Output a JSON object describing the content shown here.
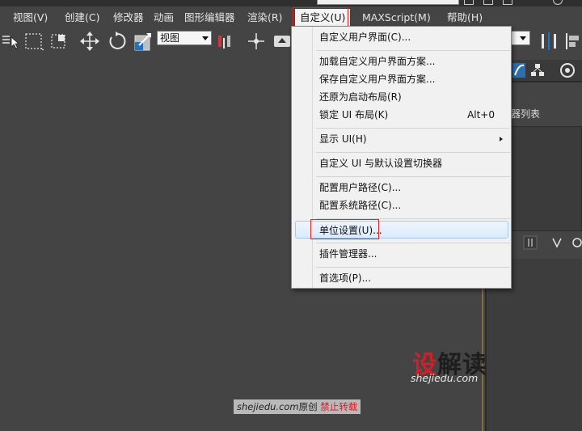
{
  "menubar": {
    "items": [
      {
        "label": "视图(V)"
      },
      {
        "label": "创建(C)"
      },
      {
        "label": "修改器"
      },
      {
        "label": "动画"
      },
      {
        "label": "图形编辑器"
      },
      {
        "label": "渲染(R)"
      },
      {
        "label": "自定义(U)"
      },
      {
        "label": "MAXScript(M)"
      },
      {
        "label": "帮助(H)"
      }
    ]
  },
  "toolbar": {
    "view_select": "视图"
  },
  "command_panel": {
    "label": "器列表"
  },
  "customize_menu": {
    "items": [
      {
        "label": "自定义用户界面(C)..."
      },
      {
        "label": "加载自定义用户界面方案..."
      },
      {
        "label": "保存自定义用户界面方案..."
      },
      {
        "label": "还原为启动布局(R)"
      },
      {
        "label": "锁定 UI 布局(K)",
        "shortcut": "Alt+0"
      },
      {
        "label": "显示 UI(H)"
      },
      {
        "label": "自定义 UI 与默认设置切换器"
      },
      {
        "label": "配置用户路径(C)..."
      },
      {
        "label": "配置系统路径(C)..."
      },
      {
        "label": "单位设置(U)..."
      },
      {
        "label": "插件管理器..."
      },
      {
        "label": "首选项(P)..."
      }
    ]
  },
  "watermark": {
    "logo_red": "设",
    "logo_dark": "解读",
    "url": "shejiedu.com",
    "bar_url": "shejiedu.com",
    "bar_original": "原创",
    "bar_notice": "禁止转载"
  },
  "colors": {
    "background": "#444444",
    "menu_bg": "#f1f1f1",
    "highlight_border": "#e0241b",
    "hover_border": "#a8c8ee",
    "brand_red": "#d0202a"
  }
}
